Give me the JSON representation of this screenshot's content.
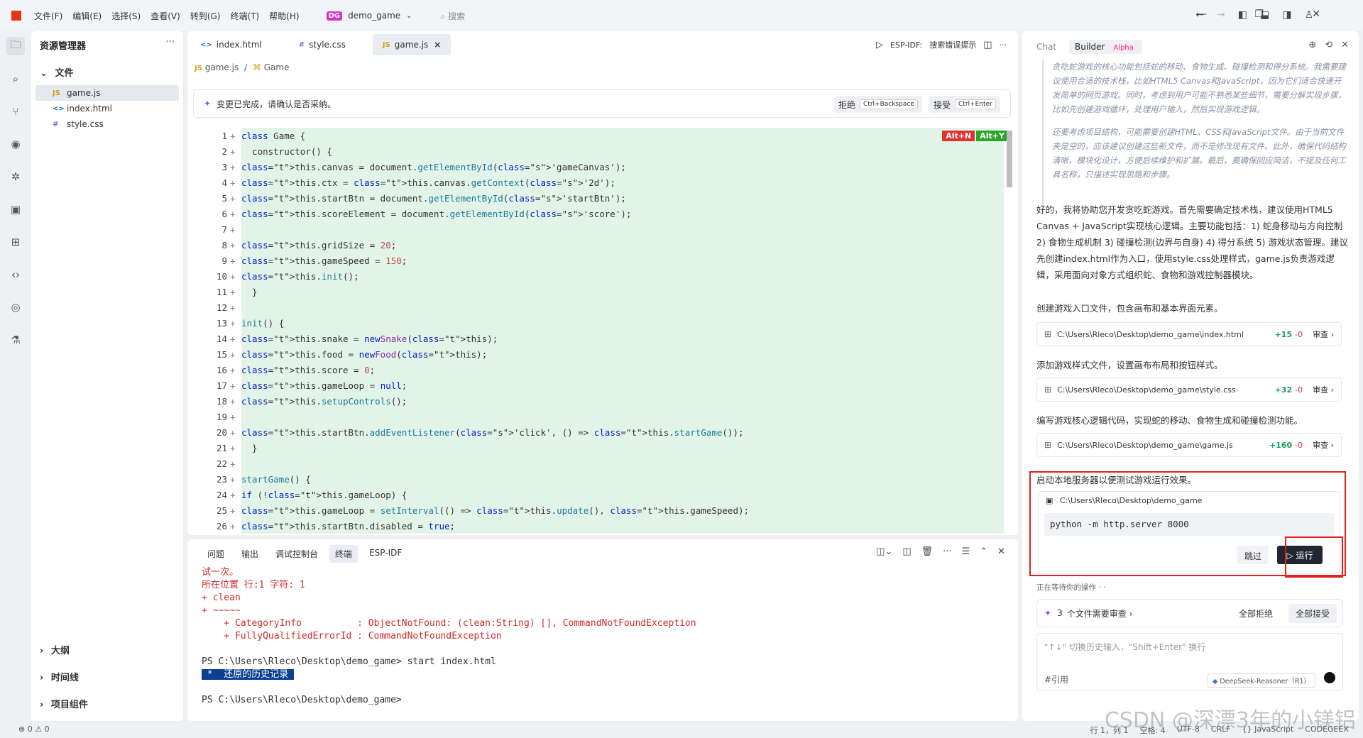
{
  "titlebar": {
    "menus": [
      "文件(F)",
      "编辑(E)",
      "选择(S)",
      "查看(V)",
      "转到(G)",
      "终端(T)",
      "帮助(H)"
    ],
    "project_badge": "DG",
    "project_name": "demo_game",
    "search_placeholder": "搜索"
  },
  "explorer": {
    "title": "资源管理器",
    "files_header": "文件",
    "files": [
      {
        "icon": "JS",
        "name": "game.js",
        "selected": true
      },
      {
        "icon": "<>",
        "name": "index.html"
      },
      {
        "icon": "#",
        "name": "style.css"
      }
    ],
    "sections": [
      "大纲",
      "时间线",
      "项目组件"
    ]
  },
  "editor": {
    "tabs": [
      {
        "icon": "<>",
        "label": "index.html"
      },
      {
        "icon": "#",
        "label": "style.css"
      },
      {
        "icon": "JS",
        "label": "game.js",
        "active": true
      }
    ],
    "esp_label": "ESP-IDF:",
    "esp_hint": "搜索错误提示",
    "breadcrumb_file": "game.js",
    "breadcrumb_sep": "/",
    "breadcrumb_symbol": "Game",
    "accept_bar": {
      "message": "变更已完成，请确认是否采纳。",
      "reject_label": "拒绝",
      "reject_shortcut": "Ctrl+Backspace",
      "accept_label": "接受",
      "accept_shortcut": "Ctrl+Enter"
    },
    "badges": [
      "Alt+N",
      "Alt+Y"
    ],
    "code_lines": [
      "class Game {",
      "  constructor() {",
      "    this.canvas = document.getElementById('gameCanvas');",
      "    this.ctx = this.canvas.getContext('2d');",
      "    this.startBtn = document.getElementById('startBtn');",
      "    this.scoreElement = document.getElementById('score');",
      "",
      "    this.gridSize = 20;",
      "    this.gameSpeed = 150;",
      "    this.init();",
      "  }",
      "",
      "  init() {",
      "    this.snake = new Snake(this);",
      "    this.food = new Food(this);",
      "    this.score = 0;",
      "    this.gameLoop = null;",
      "    this.setupControls();",
      "",
      "    this.startBtn.addEventListener('click', () => this.startGame());",
      "  }",
      "",
      "  startGame() {",
      "    if (!this.gameLoop) {",
      "      this.gameLoop = setInterval(() => this.update(), this.gameSpeed);",
      "      this.startBtn.disabled = true;"
    ]
  },
  "terminal": {
    "tabs": [
      "问题",
      "输出",
      "调试控制台",
      "终端",
      "ESP-IDF"
    ],
    "active_tab": "终端",
    "lines": [
      {
        "text": "试一次。",
        "style": "red"
      },
      {
        "text": "所在位置 行:1 字符: 1",
        "style": "red"
      },
      {
        "text": "+ clean",
        "style": "red"
      },
      {
        "text": "+ ~~~~~",
        "style": "red"
      },
      {
        "text": "    + CategoryInfo          : ObjectNotFound: (clean:String) [], CommandNotFoundException",
        "style": "red"
      },
      {
        "text": "    + FullyQualifiedErrorId : CommandNotFoundException",
        "style": "red"
      },
      {
        "text": "",
        "style": ""
      },
      {
        "text": "PS C:\\Users\\Rleco\\Desktop\\demo_game> start index.html",
        "style": ""
      },
      {
        "text": " *  还原的历史记录 ",
        "style": "hl"
      },
      {
        "text": "",
        "style": ""
      },
      {
        "text": "PS C:\\Users\\Rleco\\Desktop\\demo_game>",
        "style": ""
      }
    ]
  },
  "chat": {
    "tabs": [
      "Chat",
      "Builder"
    ],
    "builder_badge": "Alpha",
    "thinking": [
      "贪吃蛇游戏的核心功能包括蛇的移动、食物生成、碰撞检测和得分系统。我需要建议使用合适的技术栈，比如HTML5 Canvas和JavaScript，因为它们适合快速开发简单的网页游戏。同时，考虑到用户可能不熟悉某些细节，需要分解实现步骤，比如先创建游戏循环，处理用户输入，然后实现游戏逻辑。",
      "还要考虑项目结构，可能需要创建HTML、CSS和JavaScript文件。由于当前文件夹是空的，应该建议创建这些新文件，而不是修改现有文件。此外，确保代码结构清晰，模块化设计，方便后续维护和扩展。最后，要确保回应简洁，不提及任何工具名称，只描述实现思路和步骤。"
    ],
    "reply": "好的，我将协助您开发贪吃蛇游戏。首先需要确定技术栈，建议使用HTML5 Canvas + JavaScript实现核心逻辑。主要功能包括：1) 蛇身移动与方向控制 2) 食物生成机制 3) 碰撞检测(边界与自身) 4) 得分系统 5) 游戏状态管理。建议先创建index.html作为入口，使用style.css处理样式，game.js负责游戏逻辑，采用面向对象方式组织蛇、食物和游戏控制器模块。",
    "steps": [
      {
        "text": "创建游戏入口文件，包含画布和基本界面元素。",
        "path": "C:\\Users\\Rleco\\Desktop\\demo_game\\index.html",
        "add": "+15",
        "del": "-0",
        "review": "审查 ›"
      },
      {
        "text": "添加游戏样式文件，设置画布布局和按钮样式。",
        "path": "C:\\Users\\Rleco\\Desktop\\demo_game\\style.css",
        "add": "+32",
        "del": "-0",
        "review": "审查 ›"
      },
      {
        "text": "编写游戏核心逻辑代码，实现蛇的移动、食物生成和碰撞检测功能。",
        "path": "C:\\Users\\Rleco\\Desktop\\demo_game\\game.js",
        "add": "+160",
        "del": "-0",
        "review": "审查 ›"
      }
    ],
    "run_step": "启动本地服务器以便测试游戏运行效果。",
    "cmd_path": "C:\\Users\\Rleco\\Desktop\\demo_game",
    "cmd": "python -m http.server 8000",
    "skip_label": "跳过",
    "run_label": "▷ 运行",
    "waiting": "正在等待你的操作 · ·",
    "review_count": "3",
    "review_text": "个文件需要审查 ›",
    "reject_all": "全部拒绝",
    "accept_all": "全部接受",
    "input_placeholder": "\"↑↓\" 切换历史输入，\"Shift+Enter\" 换行",
    "quote_label": "#引用",
    "model": "DeepSeek-Reasoner（R1）"
  },
  "statusbar": {
    "left": "⊗ 0 ⚠ 0",
    "right": [
      "行 1，列 1",
      "空格: 4",
      "UTF-8",
      "CRLF",
      "{} JavaScript",
      "CODEGEEX"
    ]
  },
  "watermark": "CSDN @深漂3年的小镁铝",
  "colors": {
    "accent_red": "#e02020",
    "diff_green": "#e2f4e8",
    "alt_n": "#e0312f",
    "alt_y": "#2aa52a"
  }
}
